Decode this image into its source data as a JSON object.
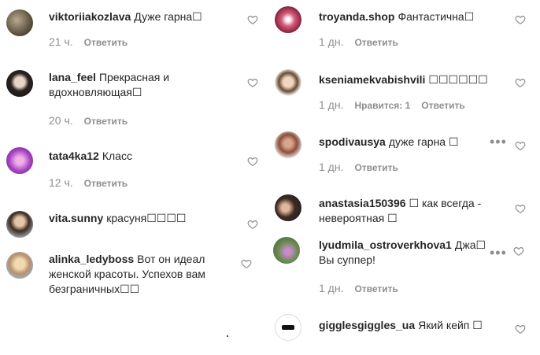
{
  "left_comments": [
    {
      "username": "viktoriiakozlava",
      "text": "Дуже гарна☐",
      "time": "21 ч.",
      "reply": "Ответить"
    },
    {
      "username": "lana_feel",
      "text": "Прекрасная и вдохновляющая☐",
      "time": "20 ч.",
      "reply": "Ответить"
    },
    {
      "username": "tata4ka12",
      "text": "Класс",
      "time": "12 ч.",
      "reply": "Ответить"
    },
    {
      "username": "vita.sunny",
      "text": "красуня☐☐☐☐"
    },
    {
      "username": "alinka_ledyboss",
      "text": "Вот он идеал женской красоты. Успехов вам безграничных☐☐"
    }
  ],
  "right_comments": [
    {
      "username": "troyanda.shop",
      "text": "Фантастична☐",
      "time": "1 дн.",
      "reply": "Ответить"
    },
    {
      "username": "kseniamekvabishvili",
      "text": "☐☐☐☐☐☐",
      "time": "1 дн.",
      "likes": "Нравится: 1",
      "reply": "Ответить"
    },
    {
      "username": "spodivausya",
      "text": "дуже гарна ☐",
      "time": "1 дн.",
      "reply": "Ответить"
    },
    {
      "username": "anastasia150396",
      "text": "☐ как всегда - невероятная ☐"
    },
    {
      "username": "lyudmila_ostroverkhova1",
      "text": "Джа☐ Вы суппер!",
      "time": "1 дн.",
      "reply": "Ответить"
    },
    {
      "username": "gigglesgiggles_ua",
      "text": "Який кейп ☐"
    }
  ],
  "icons": {
    "like": "heart-outline-icon",
    "more": "more-options-icon"
  },
  "colors": {
    "text": "#262626",
    "meta": "#8e8e8e",
    "background": "#ffffff"
  }
}
